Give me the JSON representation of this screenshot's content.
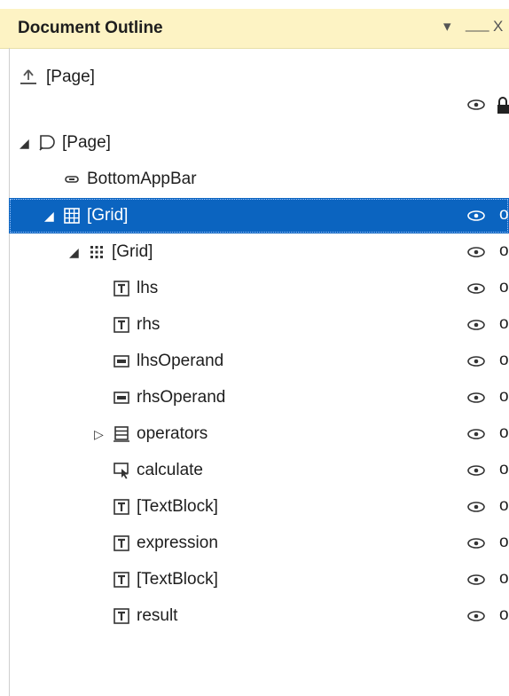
{
  "panel": {
    "title": "Document Outline",
    "controls": {
      "dropdown": "▾",
      "pin": "⸺",
      "close": "X"
    }
  },
  "back": {
    "label": "[Page]",
    "icon": "up-arrow-icon"
  },
  "header": {
    "visibility_icon": "eye-icon",
    "lock_icon": "lock-icon"
  },
  "tree": [
    {
      "label": "[Page]",
      "depth": 0,
      "expander": "expanded",
      "icon": "page-icon",
      "selected": false,
      "show_toggles": false
    },
    {
      "label": "BottomAppBar",
      "depth": 1,
      "expander": "none",
      "icon": "appbar-icon",
      "selected": false,
      "show_toggles": false
    },
    {
      "label": "[Grid]",
      "depth": 1,
      "expander": "expanded",
      "icon": "grid-icon",
      "selected": true,
      "show_toggles": true
    },
    {
      "label": "[Grid]",
      "depth": 2,
      "expander": "expanded",
      "icon": "grid-dots-icon",
      "selected": false,
      "show_toggles": true
    },
    {
      "label": "lhs",
      "depth": 3,
      "expander": "none",
      "icon": "textbox-icon",
      "selected": false,
      "show_toggles": true
    },
    {
      "label": "rhs",
      "depth": 3,
      "expander": "none",
      "icon": "textbox-icon",
      "selected": false,
      "show_toggles": true
    },
    {
      "label": "lhsOperand",
      "depth": 3,
      "expander": "none",
      "icon": "textfield-icon",
      "selected": false,
      "show_toggles": true
    },
    {
      "label": "rhsOperand",
      "depth": 3,
      "expander": "none",
      "icon": "textfield-icon",
      "selected": false,
      "show_toggles": true
    },
    {
      "label": "operators",
      "depth": 3,
      "expander": "collapsed",
      "icon": "list-icon",
      "selected": false,
      "show_toggles": true
    },
    {
      "label": "calculate",
      "depth": 3,
      "expander": "none",
      "icon": "button-icon",
      "selected": false,
      "show_toggles": true
    },
    {
      "label": "[TextBlock]",
      "depth": 3,
      "expander": "none",
      "icon": "textbox-icon",
      "selected": false,
      "show_toggles": true
    },
    {
      "label": "expression",
      "depth": 3,
      "expander": "none",
      "icon": "textbox-icon",
      "selected": false,
      "show_toggles": true
    },
    {
      "label": "[TextBlock]",
      "depth": 3,
      "expander": "none",
      "icon": "textbox-icon",
      "selected": false,
      "show_toggles": true
    },
    {
      "label": "result",
      "depth": 3,
      "expander": "none",
      "icon": "textbox-icon",
      "selected": false,
      "show_toggles": true
    }
  ],
  "colors": {
    "titlebar": "#fdf3c4",
    "selection": "#0b64c0",
    "text": "#1e1e1e"
  },
  "lock_glyph": "o"
}
